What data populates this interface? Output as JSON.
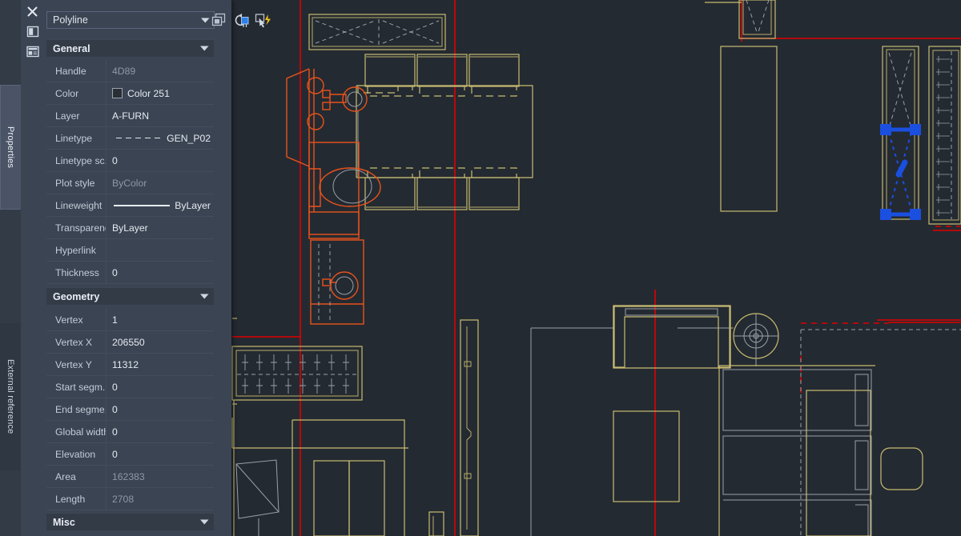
{
  "palette": {
    "tabs": [
      {
        "id": "properties",
        "label": "Properties",
        "active": true
      },
      {
        "id": "external-reference",
        "label": "External reference",
        "active": false
      }
    ],
    "close_title": "Close",
    "autohide_title": "Auto-hide",
    "menu_title": "Properties",
    "object_type": "Polyline",
    "toolbar": {
      "select_objects": "select-objects",
      "quick_select": "quick-select",
      "pickadd": "pickadd-toggle"
    },
    "sections": [
      {
        "id": "general",
        "title": "General",
        "rows": [
          {
            "name": "Handle",
            "value": "4D89",
            "style": "dim"
          },
          {
            "name": "Color",
            "value": "Color 251",
            "style": "swatch"
          },
          {
            "name": "Layer",
            "value": "A-FURN",
            "style": "normal"
          },
          {
            "name": "Linetype",
            "value": "GEN_P02",
            "style": "linetype"
          },
          {
            "name": "Linetype sc...",
            "value": "0",
            "style": "normal"
          },
          {
            "name": "Plot style",
            "value": "ByColor",
            "style": "dim"
          },
          {
            "name": "Lineweight",
            "value": "ByLayer",
            "style": "lineweight"
          },
          {
            "name": "Transparency",
            "value": "ByLayer",
            "style": "normal"
          },
          {
            "name": "Hyperlink",
            "value": "",
            "style": "normal"
          },
          {
            "name": "Thickness",
            "value": "0",
            "style": "normal"
          }
        ]
      },
      {
        "id": "geometry",
        "title": "Geometry",
        "rows": [
          {
            "name": "Vertex",
            "value": "1",
            "style": "normal"
          },
          {
            "name": "Vertex X",
            "value": "206550",
            "style": "normal"
          },
          {
            "name": "Vertex Y",
            "value": "11312",
            "style": "normal"
          },
          {
            "name": "Start segm...",
            "value": "0",
            "style": "normal"
          },
          {
            "name": "End segme...",
            "value": "0",
            "style": "normal"
          },
          {
            "name": "Global width",
            "value": "0",
            "style": "normal"
          },
          {
            "name": "Elevation",
            "value": "0",
            "style": "normal"
          },
          {
            "name": "Area",
            "value": "162383",
            "style": "dim"
          },
          {
            "name": "Length",
            "value": "2708",
            "style": "dim"
          }
        ]
      },
      {
        "id": "misc",
        "title": "Misc",
        "rows": []
      }
    ]
  },
  "colors": {
    "canvas_background": "#242a31",
    "palette_background": "#3b4452",
    "category_header": "#333b47",
    "furniture_yellow": "#c8bc72",
    "fixture_red": "#e8521c",
    "gridline_red": "#e00000",
    "selection_blue": "#1a4fe0",
    "grip_blue": "#1a4fe0",
    "hidden_gray": "#9aa0a8",
    "text_primary": "#e6ebf3",
    "text_dim": "#8e98a8"
  },
  "drawing": {
    "description": "architectural floor plan fragment",
    "selected_object": "Polyline",
    "grip_count": 4
  }
}
